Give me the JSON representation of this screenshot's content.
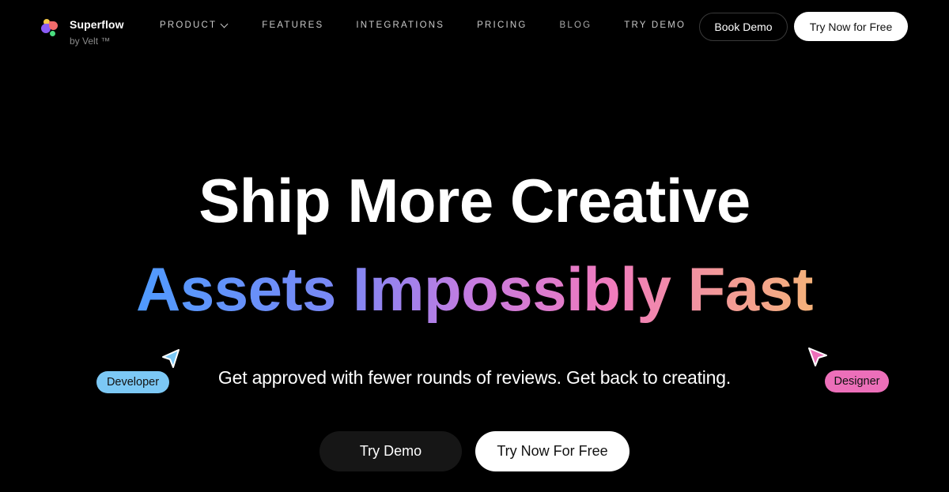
{
  "brand": {
    "name": "Superflow",
    "subtitle": "by Velt ™",
    "logo_icon": "flower-petals-logo-icon"
  },
  "nav": {
    "links": [
      {
        "label": "PRODUCT",
        "has_dropdown": true
      },
      {
        "label": "FEATURES"
      },
      {
        "label": "INTEGRATIONS"
      },
      {
        "label": "PRICING"
      },
      {
        "label": "BLOG"
      },
      {
        "label": "TRY DEMO"
      }
    ],
    "book_demo_label": "Book Demo",
    "try_now_label": "Try Now for Free"
  },
  "hero": {
    "line1": "Ship More Creative",
    "line2": "Assets Impossibly Fast",
    "subtitle": "Get approved with fewer rounds of reviews. Get back to creating.",
    "gradient_colors": [
      "#4f9bff",
      "#7b88f5",
      "#c77be0",
      "#f07bbd",
      "#f5b27a"
    ]
  },
  "cursors": {
    "developer": {
      "label": "Developer",
      "color": "#7cc8f5",
      "icon": "cursor-arrow-icon"
    },
    "designer": {
      "label": "Designer",
      "color": "#ec6fb9",
      "icon": "cursor-arrow-icon"
    }
  },
  "cta": {
    "try_demo_label": "Try Demo",
    "try_free_label": "Try Now For Free"
  }
}
